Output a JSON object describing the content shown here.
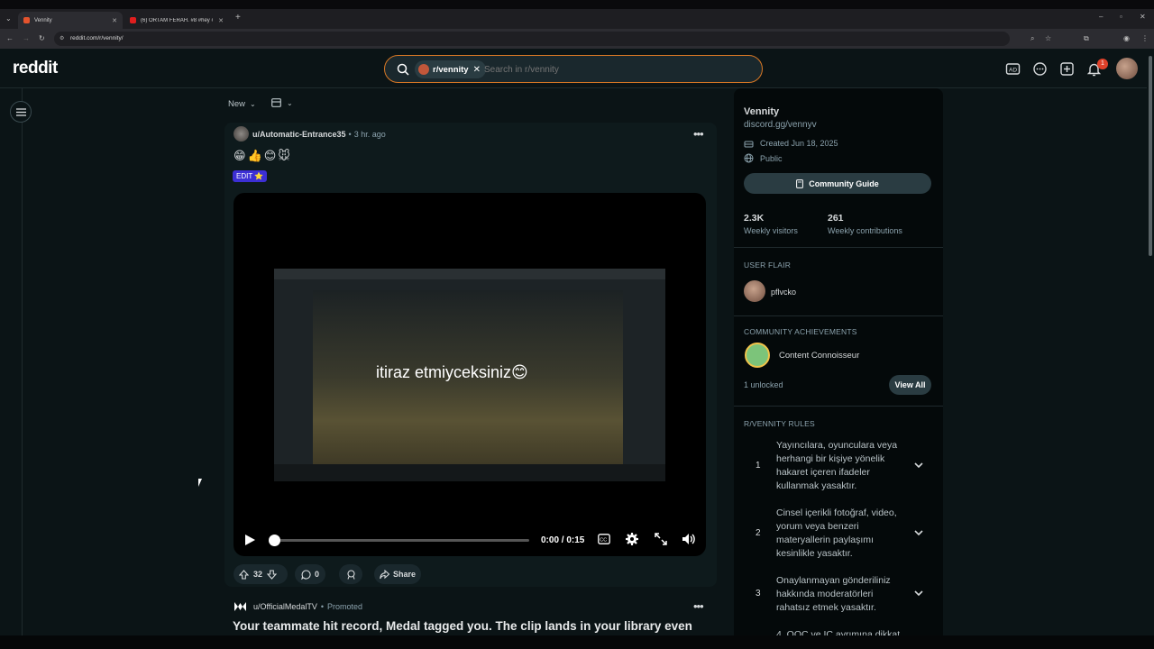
{
  "browser": {
    "tabs": [
      {
        "label": "Vennity",
        "active": true
      },
      {
        "label": "(6) ORTAM FERAH. #8 #hey #",
        "active": false
      }
    ],
    "url": "reddit.com/r/vennity/"
  },
  "header": {
    "logo": "reddit",
    "search_chip": "r/vennity",
    "search_placeholder": "Search in r/vennity",
    "notification_count": "1"
  },
  "feed": {
    "sort_label": "New",
    "post1": {
      "author": "u/Automatic-Entrance35",
      "separator": "•",
      "time": "3 hr. ago",
      "emojis": "😁👍😊🐭",
      "flair": "EDIT ⭐",
      "video_caption": "itiraz etmiyceksiniz😊",
      "video_time": "0:00 / 0:15",
      "video_progress": 0,
      "upvotes": "32",
      "comments": "0",
      "share_label": "Share"
    },
    "post2": {
      "author": "u/OfficialMedalTV",
      "separator": "•",
      "promoted": "Promoted",
      "title": "Your teammate hit record, Medal tagged you. The clip lands in your library even"
    }
  },
  "sidebar": {
    "name": "Vennity",
    "link": "discord.gg/vennyv",
    "created": "Created Jun 18, 2025",
    "visibility": "Public",
    "guide_button": "Community Guide",
    "stats": [
      {
        "value": "2.3K",
        "label": "Weekly visitors"
      },
      {
        "value": "261",
        "label": "Weekly contributions"
      }
    ],
    "user_flair_heading": "USER FLAIR",
    "user_flair_name": "pflvcko",
    "achievements_heading": "COMMUNITY ACHIEVEMENTS",
    "achievement_name": "Content Connoisseur",
    "unlocked": "1 unlocked",
    "view_all": "View All",
    "rules_heading": "R/VENNITY RULES",
    "rules": [
      {
        "num": "1",
        "text": "Yayıncılara, oyunculara veya herhangi bir kişiye yönelik hakaret içeren ifadeler kullanmak yasaktır."
      },
      {
        "num": "2",
        "text": "Cinsel içerikli fotoğraf, video, yorum veya benzeri materyallerin paylaşımı kesinlikle yasaktır."
      },
      {
        "num": "3",
        "text": "Onaylanmayan gönderiliniz hakkında moderatörleri rahatsız etmek yasaktır."
      },
      {
        "num": "",
        "text": "4. OOC ve IC ayrımına dikkat"
      }
    ]
  }
}
